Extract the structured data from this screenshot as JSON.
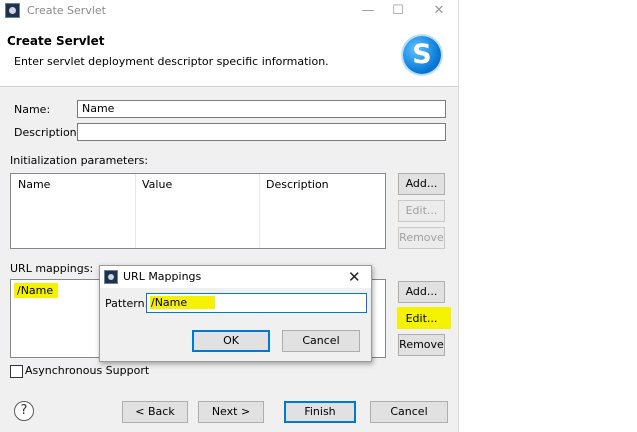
{
  "window": {
    "title": "Create Servlet",
    "minimize_glyph": "—",
    "maximize_glyph": "☐",
    "close_glyph": "✕"
  },
  "banner": {
    "title": "Create Servlet",
    "subtitle": "Enter servlet deployment descriptor specific information.",
    "logo_letter": "S"
  },
  "form": {
    "name_label": "Name:",
    "name_value": "Name",
    "description_label": "Description:",
    "description_value": ""
  },
  "init_params": {
    "label": "Initialization parameters:",
    "columns": [
      "Name",
      "Value",
      "Description"
    ],
    "buttons": {
      "add": "Add...",
      "edit": "Edit...",
      "remove": "Remove"
    }
  },
  "url_mappings": {
    "label": "URL mappings:",
    "items": [
      "/Name"
    ],
    "buttons": {
      "add": "Add...",
      "edit": "Edit...",
      "remove": "Remove"
    }
  },
  "async": {
    "label": "Asynchronous Support",
    "checked": false
  },
  "footer": {
    "help_glyph": "?",
    "back": "< Back",
    "next": "Next >",
    "finish": "Finish",
    "cancel": "Cancel"
  },
  "mapping_dialog": {
    "title": "URL Mappings",
    "close_glyph": "✕",
    "pattern_label": "Pattern:",
    "pattern_value": "/Name",
    "ok": "OK",
    "cancel": "Cancel"
  },
  "colors": {
    "highlight": "#f5f200",
    "focus_border": "#0078d7",
    "logo_blue": "#0a78d6"
  }
}
